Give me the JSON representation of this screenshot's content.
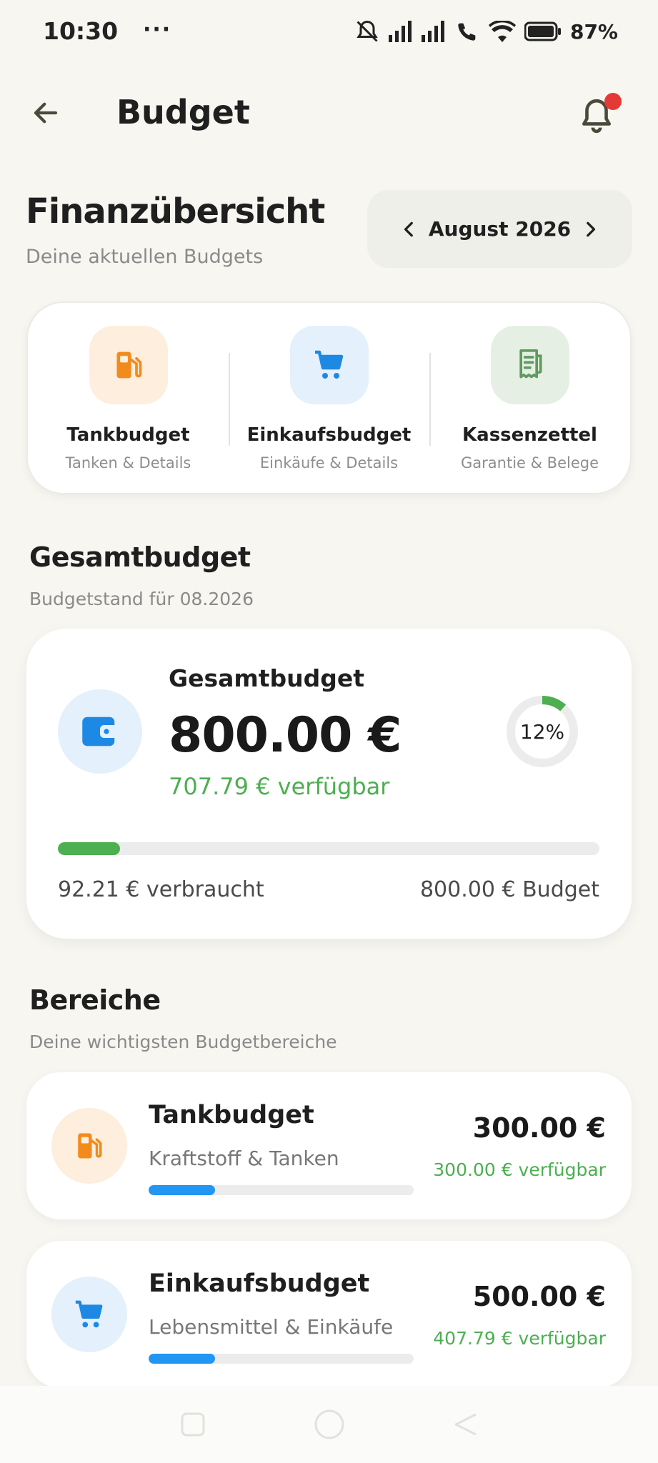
{
  "status_bar": {
    "time": "10:30",
    "dots": "···",
    "battery": "87%"
  },
  "app_bar": {
    "title": "Budget",
    "back_icon": "arrow-left-icon",
    "bell_icon": "bell-icon",
    "notification_dot_color": "#e53935"
  },
  "header": {
    "title": "Finanzübersicht",
    "subtitle": "Deine aktuellen Budgets",
    "month": "August 2026"
  },
  "quick_links": [
    {
      "label": "Tankbudget",
      "sub": "Tanken & Details",
      "icon": "fuel-pump-icon",
      "color": "#f28b1c",
      "bg": "#fdeedd"
    },
    {
      "label": "Einkaufsbudget",
      "sub": "Einkäufe & Details",
      "icon": "cart-icon",
      "color": "#1e88e5",
      "bg": "#e4f0fb"
    },
    {
      "label": "Kassenzettel",
      "sub": "Garantie & Belege",
      "icon": "receipt-icon",
      "color": "#5f9a5f",
      "bg": "#e6efe4"
    }
  ],
  "overview_section": {
    "title": "Gesamtbudget",
    "subtitle": "Budgetstand für 08.2026"
  },
  "overview_card": {
    "label": "Gesamtbudget",
    "amount": "800.00 €",
    "available": "707.79 € verfügbar",
    "percent_label": "12%",
    "used_fraction": 0.115,
    "used": "92.21 € verbraucht",
    "budget": "800.00 € Budget",
    "icon": "wallet-icon"
  },
  "areas_section": {
    "title": "Bereiche",
    "subtitle": "Deine wichtigsten Budgetbereiche"
  },
  "areas": [
    {
      "name": "Tankbudget",
      "desc": "Kraftstoff & Tanken",
      "amount": "300.00 €",
      "available": "300.00 € verfügbar",
      "progress_fraction": 0.25,
      "icon": "fuel-pump-icon"
    },
    {
      "name": "Einkaufsbudget",
      "desc": "Lebensmittel & Einkäufe",
      "amount": "500.00 €",
      "available": "407.79 € verfügbar",
      "progress_fraction": 0.25,
      "icon": "cart-icon"
    }
  ],
  "colors": {
    "accent_green": "#4caf50",
    "accent_blue": "#2196f3",
    "background": "#f7f6f1"
  }
}
